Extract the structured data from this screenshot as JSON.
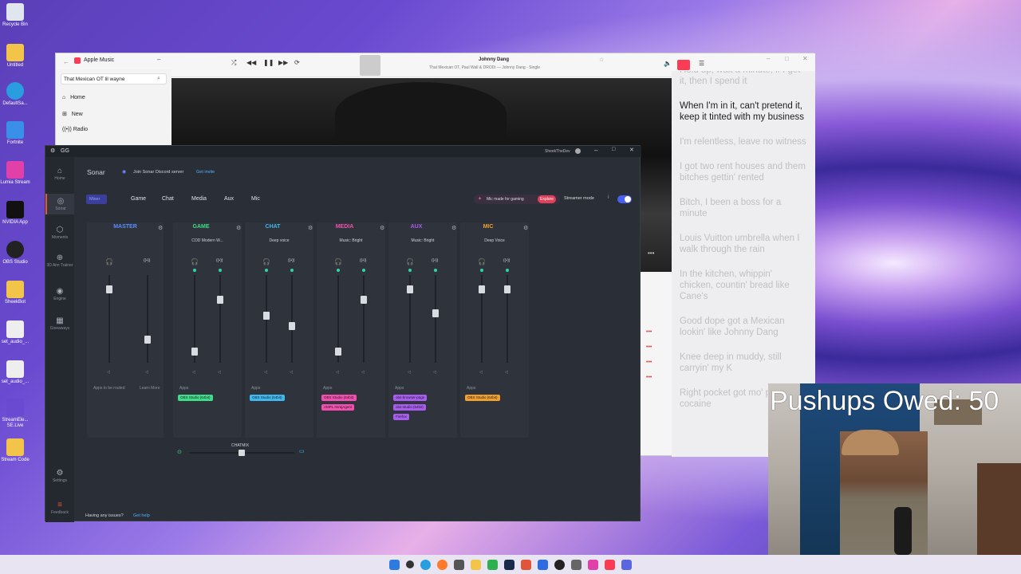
{
  "desktop": {
    "icons": [
      "Recycle Bin",
      "Untitled",
      "DefaultSa...",
      "Fortnite",
      "Lumia Stream",
      "NVIDIA App",
      "OBS Studio",
      "SheekBot",
      "set_audio_...",
      "set_audio_...",
      "StreamEle... SE.Live",
      "Stream Code"
    ]
  },
  "apple_music": {
    "title": "Apple Music",
    "search_value": "That Mexican OT lil wayne",
    "nav": [
      "Home",
      "New",
      "Radio"
    ],
    "now_playing": {
      "title": "Johnny Dang",
      "subtitle": "That Mexican OT, Paul Wall & DRODi — Johnny Dang - Single"
    },
    "lyrics": [
      {
        "text": "Hold up, wait a minute, if I get it, then I spend it",
        "active": false
      },
      {
        "text": "When I'm in it, can't pretend it, keep it tinted with my business",
        "active": true
      },
      {
        "text": "I'm relentless, leave no witness",
        "active": false
      },
      {
        "text": "I got two rent houses and them bitches gettin' rented",
        "active": false
      },
      {
        "text": "Bitch, I been a boss for a minute",
        "active": false
      },
      {
        "text": "Louis Vuitton umbrella when I walk through the rain",
        "active": false
      },
      {
        "text": "In the kitchen, whippin' chicken, countin' bread like Cane's",
        "active": false
      },
      {
        "text": "Good dope got a Mexican lookin' like Johnny Dang",
        "active": false
      },
      {
        "text": "Knee deep in muddy, still carryin' my K",
        "active": false
      },
      {
        "text": "Right pocket got mo' pocket cocaine",
        "active": false
      }
    ]
  },
  "gg": {
    "app_title": "GG",
    "user": "SheekTheDev",
    "nav": [
      "Home",
      "Sonar",
      "Moments",
      "3D Aim Trainer",
      "Engine",
      "Giveaways",
      "Settings",
      "Feedback"
    ],
    "page_title": "Sonar",
    "discord_text": "Join Sonar Discord server",
    "discord_link": "Get invite",
    "tabs": [
      "Mixer",
      "Game",
      "Chat",
      "Media",
      "Aux",
      "Mic"
    ],
    "promo_text": "Mic made for gaming",
    "promo_link": "Explore",
    "streamer_mode": "Streamer mode",
    "channels": [
      {
        "name": "MASTER",
        "preset": "",
        "color": "#5b8cff",
        "apps": [],
        "apps_label": "Apps to be routed",
        "learn": "Learn More"
      },
      {
        "name": "GAME",
        "preset": "COD Modern W...",
        "color": "#3fdc8a",
        "apps": [
          "OBS Studio (64bit)"
        ],
        "apps_label": "Apps"
      },
      {
        "name": "CHAT",
        "preset": "Deep voice",
        "color": "#3fb8f0",
        "apps": [
          "OBS Studio (64bit)"
        ],
        "apps_label": "Apps"
      },
      {
        "name": "MEDIA",
        "preset": "Music: Bright",
        "color": "#f24fb0",
        "apps": [
          "OBS Studio (64bit)",
          "AMPL ImrajAgent"
        ],
        "apps_label": "Apps"
      },
      {
        "name": "AUX",
        "preset": "Music: Bright",
        "color": "#a85cf0",
        "apps": [
          "obs-browser-page",
          "obs-studio (64bit)",
          "Firefox"
        ],
        "apps_label": "Apps"
      },
      {
        "name": "MIC",
        "preset": "Deep Voice",
        "color": "#f0a030",
        "apps": [
          "OBS Studio (64bit)"
        ],
        "apps_label": "Apps"
      }
    ],
    "chatmix": "CHATMIX",
    "footer_text": "Having any issues?",
    "footer_link": "Get help"
  },
  "overlay": {
    "pushups": "Pushups Owed: 50"
  }
}
